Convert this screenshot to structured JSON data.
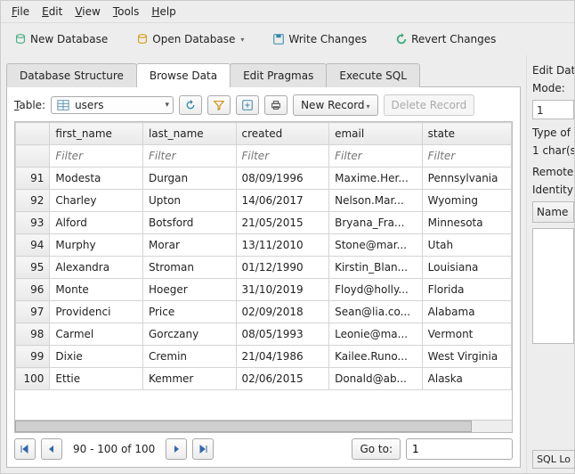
{
  "menubar": [
    "File",
    "Edit",
    "View",
    "Tools",
    "Help"
  ],
  "toolbar": {
    "new_db": "New Database",
    "open_db": "Open Database",
    "write": "Write Changes",
    "revert": "Revert Changes"
  },
  "tabs": {
    "structure": "Database Structure",
    "browse": "Browse Data",
    "pragmas": "Edit Pragmas",
    "sql": "Execute SQL"
  },
  "table_picker": {
    "label": "Table:",
    "value": "users"
  },
  "actions": {
    "new_record": "New Record",
    "delete_record": "Delete Record"
  },
  "columns": [
    "first_name",
    "last_name",
    "created",
    "email",
    "state"
  ],
  "filter_placeholder": "Filter",
  "rows": [
    {
      "n": 91,
      "first_name": "Modesta",
      "last_name": "Durgan",
      "created": "08/09/1996",
      "email": "Maxime.Her...",
      "state": "Pennsylvania"
    },
    {
      "n": 92,
      "first_name": "Charley",
      "last_name": "Upton",
      "created": "14/06/2017",
      "email": "Nelson.Mar...",
      "state": "Wyoming"
    },
    {
      "n": 93,
      "first_name": "Alford",
      "last_name": "Botsford",
      "created": "21/05/2015",
      "email": "Bryana_Fra...",
      "state": "Minnesota"
    },
    {
      "n": 94,
      "first_name": "Murphy",
      "last_name": "Morar",
      "created": "13/11/2010",
      "email": "Stone@mar...",
      "state": "Utah"
    },
    {
      "n": 95,
      "first_name": "Alexandra",
      "last_name": "Stroman",
      "created": "01/12/1990",
      "email": "Kirstin_Blan...",
      "state": "Louisiana"
    },
    {
      "n": 96,
      "first_name": "Monte",
      "last_name": "Hoeger",
      "created": "31/10/2019",
      "email": "Floyd@holly...",
      "state": "Florida"
    },
    {
      "n": 97,
      "first_name": "Providenci",
      "last_name": "Price",
      "created": "02/09/2018",
      "email": "Sean@lia.co...",
      "state": "Alabama"
    },
    {
      "n": 98,
      "first_name": "Carmel",
      "last_name": "Gorczany",
      "created": "08/05/1993",
      "email": "Leonie@ma...",
      "state": "Vermont"
    },
    {
      "n": 99,
      "first_name": "Dixie",
      "last_name": "Cremin",
      "created": "21/04/1986",
      "email": "Kailee.Runo...",
      "state": "West Virginia"
    },
    {
      "n": 100,
      "first_name": "Ettie",
      "last_name": "Kemmer",
      "created": "02/06/2015",
      "email": "Donald@ab...",
      "state": "Alaska"
    }
  ],
  "pager": {
    "range": "90 - 100 of 100",
    "goto_label": "Go to:",
    "goto_value": "1"
  },
  "right": {
    "edit_cell": "Edit Data",
    "mode": "Mode:",
    "mode_val": "1",
    "type": "Type of",
    "chars": "1 char(s",
    "remote": "Remote",
    "identity": "Identity",
    "name": "Name",
    "sql_log": "SQL Lo"
  }
}
